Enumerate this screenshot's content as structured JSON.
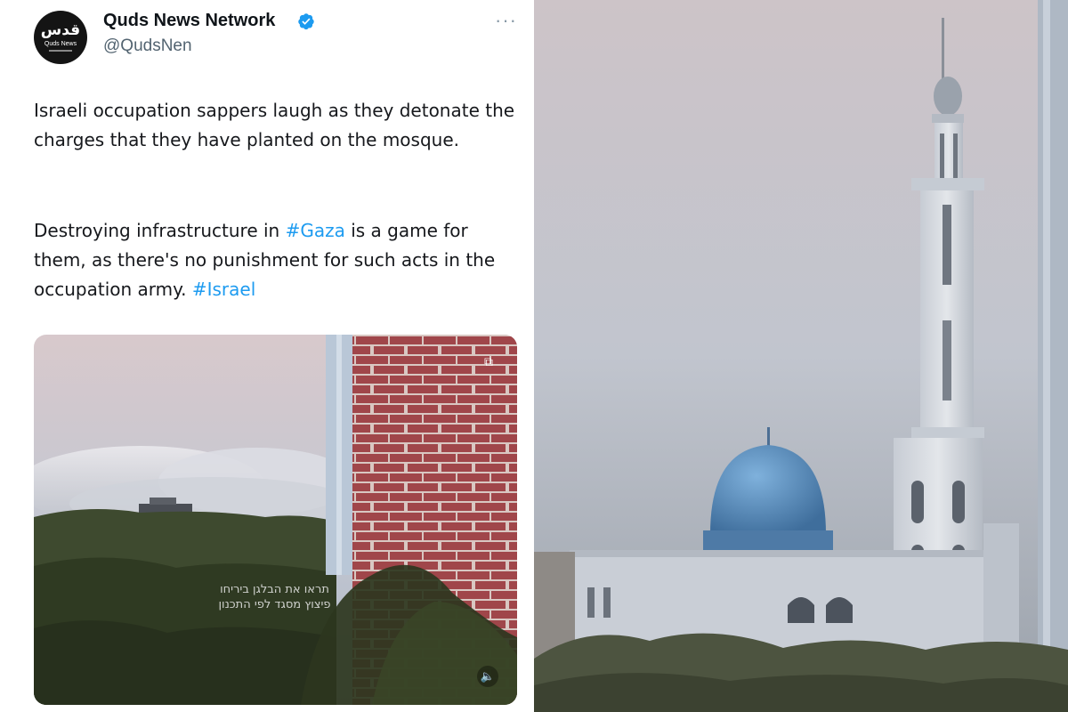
{
  "tweet": {
    "avatar": {
      "mark": "قدس",
      "sub": "Quds News"
    },
    "display_name": "Quds News Network",
    "verified_icon": "verified-badge-icon",
    "handle": "@QudsNen",
    "more_icon": "ellipsis-icon",
    "paragraph1": "Israeli occupation sappers laugh as they detonate the charges that they have planted on the mosque.",
    "paragraph2": {
      "t1": "Destroying infrastructure in ",
      "tag1": "#Gaza",
      "t2": " is a game for them, as there's no punishment for such acts in the occupation army. ",
      "tag2": "#Israel"
    },
    "media": {
      "caption_line1": "תראו את הבלגן ביריחו",
      "caption_line2": "פיצוץ מסגד לפי התכנון",
      "gif_icon": "media-toggle-icon",
      "mute_icon": "speaker-icon"
    }
  },
  "colors": {
    "hashtag": "#1d9bf0",
    "verified": "#1d9bf0",
    "text": "#16181c",
    "handle": "#536471"
  }
}
